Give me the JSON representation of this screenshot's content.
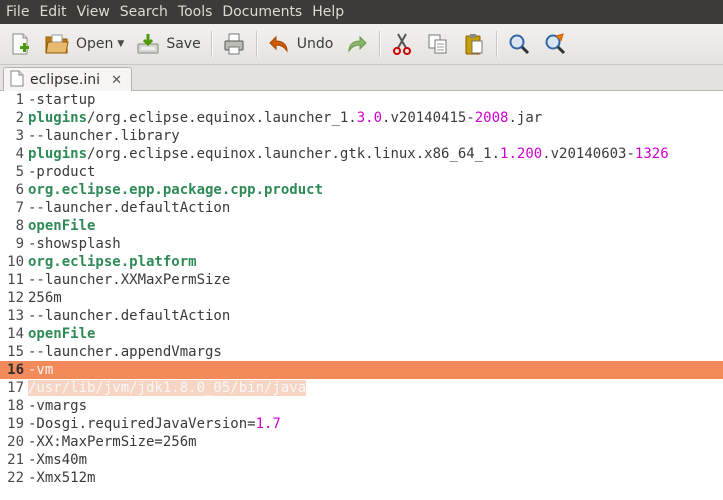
{
  "menu": [
    "File",
    "Edit",
    "View",
    "Search",
    "Tools",
    "Documents",
    "Help"
  ],
  "toolbar": {
    "open_label": "Open",
    "save_label": "Save",
    "undo_label": "Undo"
  },
  "tab": {
    "title": "eclipse.ini",
    "close": "✕"
  },
  "editor": {
    "highlight_color": "#f28a5a",
    "lines": [
      {
        "n": "1",
        "segs": [
          [
            "plain",
            "-startup"
          ]
        ]
      },
      {
        "n": "2",
        "segs": [
          [
            "kw",
            "plugins"
          ],
          [
            "plain",
            "/org.eclipse.equinox.launcher_1."
          ],
          [
            "num",
            "3.0"
          ],
          [
            "plain",
            ".v20140415-"
          ],
          [
            "num",
            "2008"
          ],
          [
            "plain",
            ".jar"
          ]
        ]
      },
      {
        "n": "3",
        "segs": [
          [
            "plain",
            "--launcher.library"
          ]
        ]
      },
      {
        "n": "4",
        "segs": [
          [
            "kw",
            "plugins"
          ],
          [
            "plain",
            "/org.eclipse.equinox.launcher.gtk.linux.x86_64_1."
          ],
          [
            "num",
            "1.200"
          ],
          [
            "plain",
            ".v20140603-"
          ],
          [
            "num",
            "1326"
          ]
        ]
      },
      {
        "n": "5",
        "segs": [
          [
            "plain",
            "-product"
          ]
        ]
      },
      {
        "n": "6",
        "segs": [
          [
            "kw",
            "org.eclipse.epp.package.cpp.product"
          ]
        ]
      },
      {
        "n": "7",
        "segs": [
          [
            "plain",
            "--launcher.defaultAction"
          ]
        ]
      },
      {
        "n": "8",
        "segs": [
          [
            "kw",
            "openFile"
          ]
        ]
      },
      {
        "n": "9",
        "segs": [
          [
            "plain",
            "-showsplash"
          ]
        ]
      },
      {
        "n": "10",
        "segs": [
          [
            "kw",
            "org.eclipse.platform"
          ]
        ]
      },
      {
        "n": "11",
        "segs": [
          [
            "plain",
            "--launcher.XXMaxPermSize"
          ]
        ]
      },
      {
        "n": "12",
        "segs": [
          [
            "plain",
            "256m"
          ]
        ]
      },
      {
        "n": "13",
        "segs": [
          [
            "plain",
            "--launcher.defaultAction"
          ]
        ]
      },
      {
        "n": "14",
        "segs": [
          [
            "kw",
            "openFile"
          ]
        ]
      },
      {
        "n": "15",
        "segs": [
          [
            "plain",
            "--launcher.appendVmargs"
          ]
        ]
      },
      {
        "n": "16",
        "segs": [
          [
            "plain",
            "-vm"
          ]
        ],
        "highlight": true,
        "current": true
      },
      {
        "n": "17",
        "segs": [
          [
            "sel",
            "/usr/lib/jvm/jdk1.8.0_05/bin/java"
          ]
        ]
      },
      {
        "n": "18",
        "segs": [
          [
            "plain",
            "-vmargs"
          ]
        ]
      },
      {
        "n": "19",
        "segs": [
          [
            "plain",
            "-Dosgi.requiredJavaVersion="
          ],
          [
            "num",
            "1.7"
          ]
        ]
      },
      {
        "n": "20",
        "segs": [
          [
            "plain",
            "-XX:MaxPermSize=256m"
          ]
        ]
      },
      {
        "n": "21",
        "segs": [
          [
            "plain",
            "-Xms40m"
          ]
        ]
      },
      {
        "n": "22",
        "segs": [
          [
            "plain",
            "-Xmx512m"
          ]
        ]
      }
    ]
  }
}
